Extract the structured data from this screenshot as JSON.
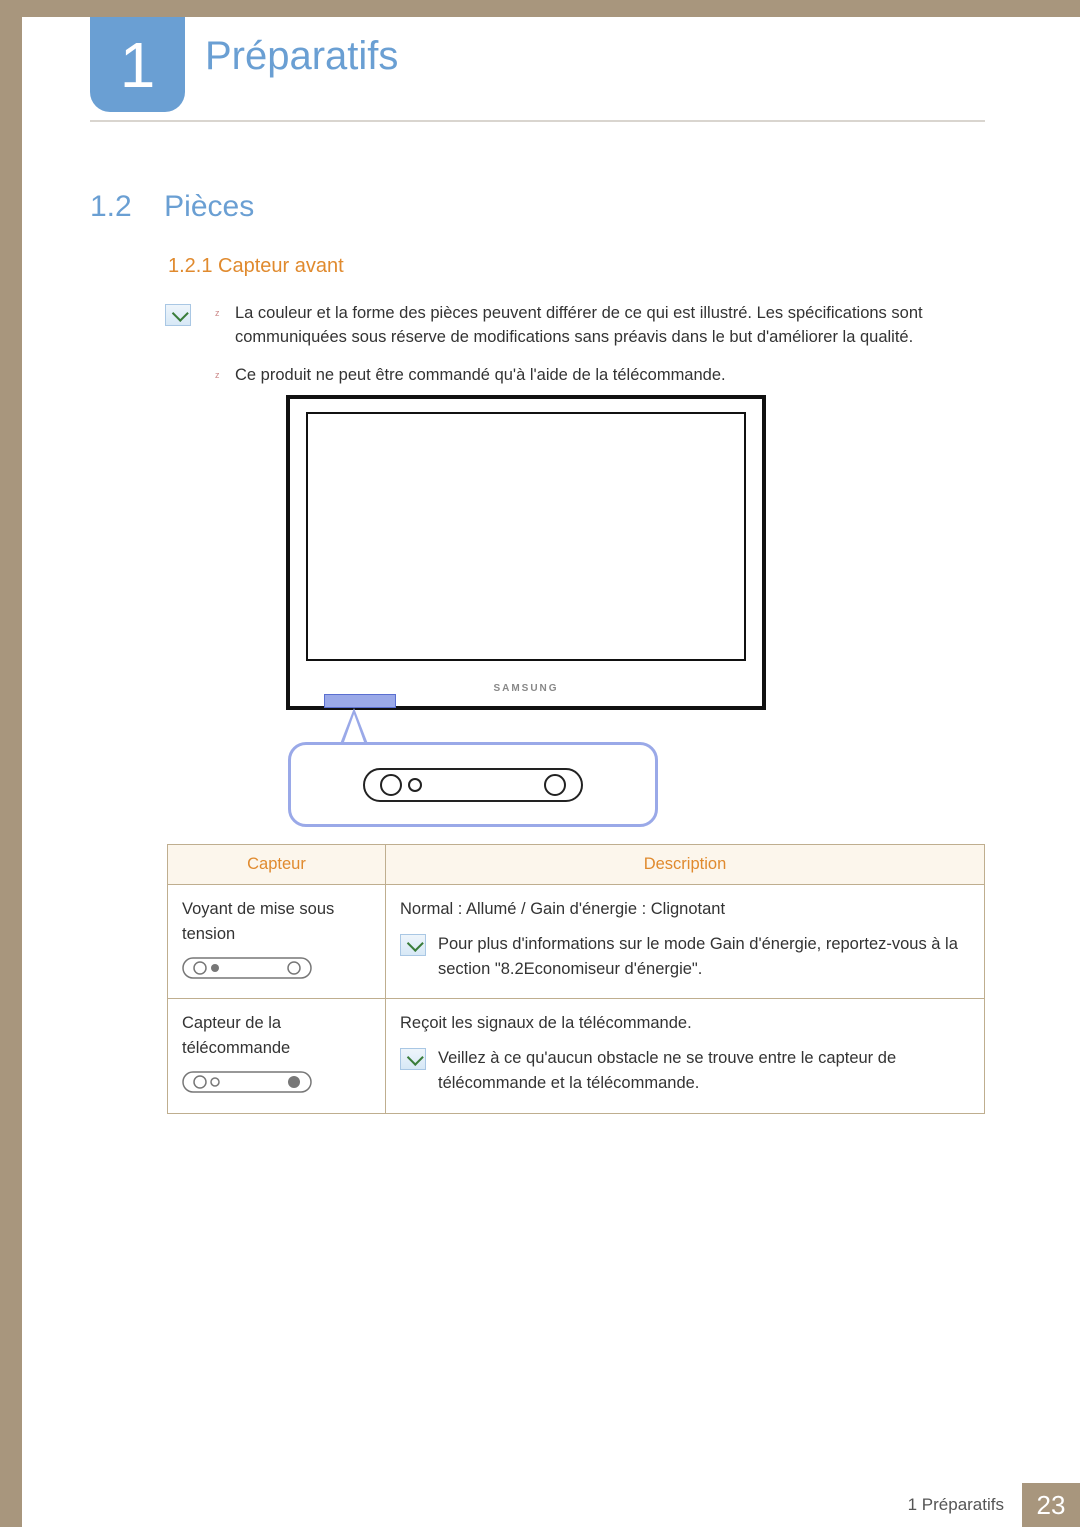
{
  "chapter": {
    "number": "1",
    "title": "Préparatifs"
  },
  "section": {
    "number": "1.2",
    "title": "Pièces"
  },
  "subsection": {
    "number": "1.2.1",
    "title": "Capteur avant",
    "full": "1.2.1 Capteur avant"
  },
  "notes": {
    "item1": "La couleur et la forme des pièces peuvent différer de ce qui est illustré. Les spécifications sont communiquées sous réserve de modifications sans préavis dans le but d'améliorer la qualité.",
    "item2": "Ce produit ne peut être commandé qu'à l'aide de la télécommande."
  },
  "monitor_brand": "SAMSUNG",
  "table": {
    "header": {
      "col1": "Capteur",
      "col2": "Description"
    },
    "row1": {
      "label": "Voyant de mise sous tension",
      "desc": "Normal : Allumé / Gain d'énergie : Clignotant",
      "note": "Pour plus d'informations sur le mode Gain d'énergie, reportez-vous à la section \"8.2Economiseur d'énergie\"."
    },
    "row2": {
      "label": "Capteur de la télécommande",
      "desc": "Reçoit les signaux de la télécommande.",
      "note": "Veillez à ce qu'aucun obstacle ne se trouve entre le capteur de télécommande et la télécommande."
    }
  },
  "footer": {
    "label": "1 Préparatifs",
    "page": "23"
  }
}
